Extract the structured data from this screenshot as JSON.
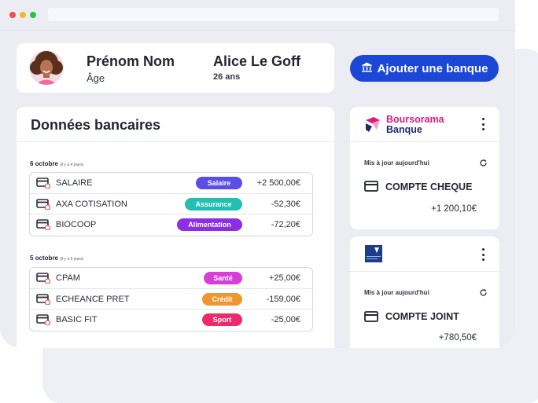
{
  "profile": {
    "label": "Prénom Nom",
    "sub_label": "Âge",
    "name": "Alice Le Goff",
    "age": "26 ans"
  },
  "add_bank_button": {
    "label": "Ajouter une banque",
    "icon": "bank-icon"
  },
  "bank_data": {
    "title": "Données bancaires",
    "groups": [
      {
        "date": "6 octobre",
        "relative": "(il y a 4 jours)",
        "transactions": [
          {
            "label": "SALAIRE",
            "category": "Salaire",
            "category_color": "#5a4ee6",
            "amount": "+2 500,00€"
          },
          {
            "label": "AXA COTISATION",
            "category": "Assurance",
            "category_color": "#23bfb2",
            "amount": "-52,30€"
          },
          {
            "label": "BIOCOOP",
            "category": "Alimentation",
            "category_color": "#8b2ee6",
            "amount": "-72,20€"
          }
        ]
      },
      {
        "date": "5 octobre",
        "relative": "(il y a 5 jours)",
        "transactions": [
          {
            "label": "CPAM",
            "category": "Santé",
            "category_color": "#d93fd6",
            "amount": "+25,00€"
          },
          {
            "label": "ECHEANCE PRET",
            "category": "Crédit",
            "category_color": "#f0962f",
            "amount": "-159,00€"
          },
          {
            "label": "BASIC FIT",
            "category": "Sport",
            "category_color": "#ee2a6a",
            "amount": "-25,00€"
          }
        ]
      }
    ]
  },
  "banks": [
    {
      "name_line1": "Boursorama",
      "name_line2": "Banque",
      "brand_color": "#e5197d",
      "updated": "Mis à jour aujourd'hui",
      "account": "COMPTE CHEQUE",
      "balance": "+1 200,10€"
    },
    {
      "logo_icon": "bank-logo-icon",
      "brand_color": "#1c3c8c",
      "updated": "Mis à jour aujourd'hui",
      "account": "COMPTE JOINT",
      "balance": "+780,50€"
    }
  ]
}
